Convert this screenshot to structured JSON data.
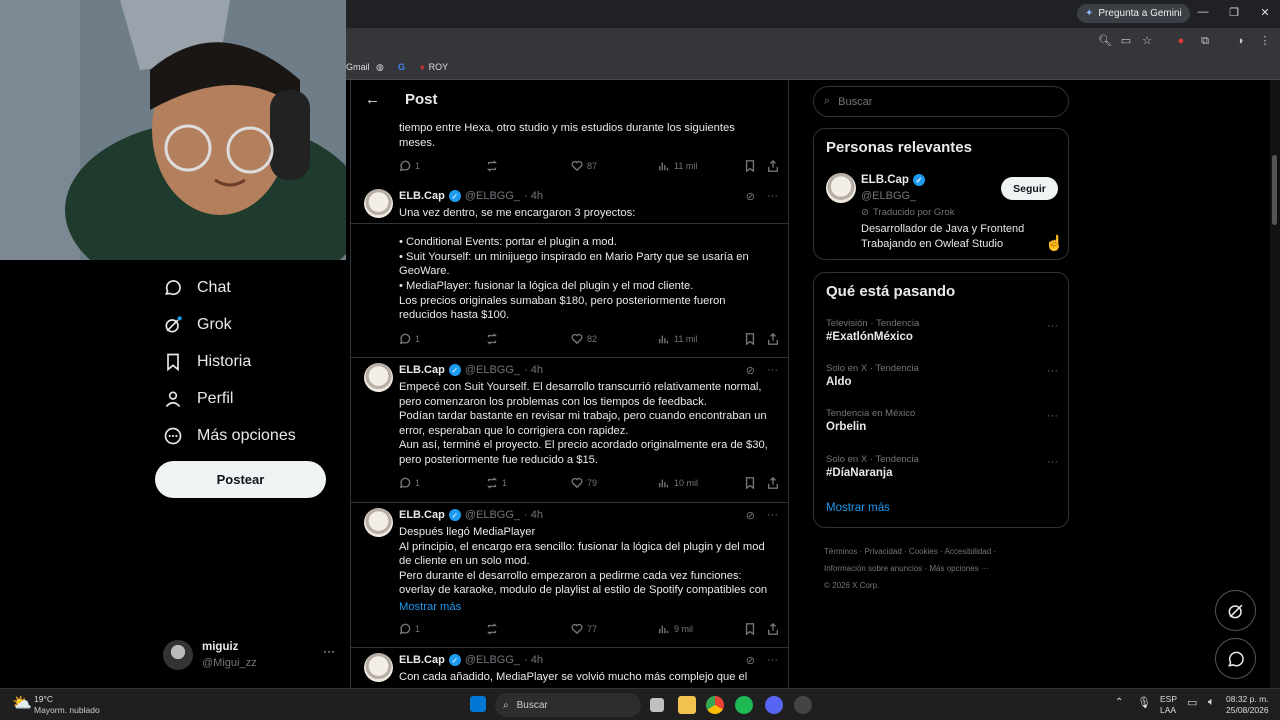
{
  "browser": {
    "gemini_button": "Pregunta a Gemini",
    "bookmarks": [
      "Gmail",
      "ROY"
    ]
  },
  "sidebar": {
    "nav": [
      {
        "label": "Chat",
        "icon": "chat-icon"
      },
      {
        "label": "Grok",
        "icon": "grok-icon"
      },
      {
        "label": "Historia",
        "icon": "bookmark-icon"
      },
      {
        "label": "Perfil",
        "icon": "person-icon"
      },
      {
        "label": "Más opciones",
        "icon": "more-circle-icon"
      }
    ],
    "post_button": "Postear",
    "account": {
      "name": "miguiz",
      "handle": "@Migui_zz"
    }
  },
  "feed": {
    "header_title": "Post",
    "top_partial": {
      "text": "tiempo entre Hexa, otro studio y mis estudios durante los siguientes\nmeses.",
      "replies": "1",
      "reposts": "",
      "likes": "87",
      "views": "11 mil"
    },
    "tweets": [
      {
        "name": "ELB.Cap",
        "handle": "@ELBGG_",
        "time": "· 4h",
        "text": "Una vez dentro, se me encargaron 3 proyectos:\n\n• Conditional Events: portar el plugin a mod.\n• Suit Yourself: un minijuego inspirado en Mario Party que se usaría en\nGeoWare.\n• MediaPlayer: fusionar la lógica del plugin y el mod cliente.\nLos precios originales sumaban $180, pero posteriormente fueron\nreducidos hasta $100.",
        "replies": "1",
        "reposts": "",
        "likes": "82",
        "views": "11 mil"
      },
      {
        "name": "ELB.Cap",
        "handle": "@ELBGG_",
        "time": "· 4h",
        "text": "Empecé con Suit Yourself. El desarrollo transcurrió relativamente normal,\npero comenzaron los problemas con los tiempos de feedback.\nPodían tardar bastante en revisar mi trabajo, pero cuando encontraban un\nerror, esperaban que lo corrigiera con rapidez.\nAun así, terminé el proyecto. El precio acordado originalmente era de $30,\npero posteriormente fue reducido a $15.",
        "replies": "1",
        "reposts": "1",
        "likes": "79",
        "views": "10 mil"
      },
      {
        "name": "ELB.Cap",
        "handle": "@ELBGG_",
        "time": "· 4h",
        "text": "Después llegó MediaPlayer\nAl principio, el encargo era sencillo: fusionar la lógica del plugin y del mod\nde cliente en un solo mod.\nPero durante el desarrollo empezaron a pedirme cada vez funciones:\noverlay de karaoke, modulo de playlist al estilo de Spotify compatibles con",
        "show_more": "Mostrar más",
        "replies": "1",
        "reposts": "",
        "likes": "77",
        "views": "9 mil"
      },
      {
        "name": "ELB.Cap",
        "handle": "@ELBGG_",
        "time": "· 4h",
        "text": "Con cada añadido, MediaPlayer se volvió mucho más complejo que el",
        "replies": "",
        "reposts": "",
        "likes": "",
        "views": ""
      }
    ]
  },
  "right": {
    "search_placeholder": "Buscar",
    "relevant": {
      "title": "Personas relevantes",
      "name": "ELB.Cap",
      "handle": "@ELBGG_",
      "translated": "Traducido por Grok",
      "bio": "Desarrollador de Java y Frontend\nTrabajando en Owleaf Studio",
      "follow": "Seguir"
    },
    "trending": {
      "title": "Qué está pasando",
      "items": [
        {
          "context": "Televisión · Tendencia",
          "topic": "#ExatlónMéxico"
        },
        {
          "context": "Solo en X · Tendencia",
          "topic": "Aldo"
        },
        {
          "context": "Tendencia en México",
          "topic": "Orbelin"
        },
        {
          "context": "Solo en X · Tendencia",
          "topic": "#DíaNaranja"
        }
      ],
      "show_more": "Mostrar más"
    },
    "footer": {
      "links": [
        "Términos",
        "Privacidad",
        "Cookies",
        "Accesibilidad",
        "Información sobre anuncios",
        "Más opciones ···"
      ],
      "copyright": "© 2026 X Corp."
    }
  },
  "taskbar": {
    "weather_temp": "19°C",
    "weather_desc": "Mayorm. nublado",
    "search": "Buscar",
    "lang1": "ESP",
    "lang2": "LAA",
    "time": "08:32 p. m.",
    "date": "25/08/2026"
  }
}
